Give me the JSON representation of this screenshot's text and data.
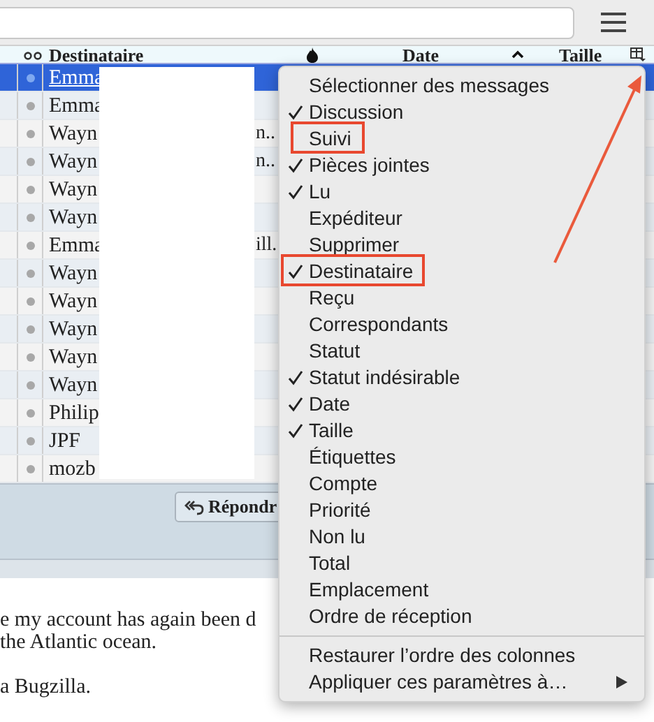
{
  "columns": [
    {
      "kind": "recipient",
      "label": "Destinataire",
      "sorted": false
    },
    {
      "kind": "junk",
      "sorted": false
    },
    {
      "kind": "date",
      "label": "Date",
      "sorted": true
    },
    {
      "kind": "size",
      "label": "Taille",
      "sorted": false
    }
  ],
  "rows": [
    {
      "recipient": "Emma",
      "selected": true
    },
    {
      "recipient": "Emma",
      "selected": false
    },
    {
      "recipient": "Wayn",
      "tail": "n..",
      "selected": false
    },
    {
      "recipient": "Wayn",
      "tail": "n..",
      "selected": false
    },
    {
      "recipient": "Wayn",
      "selected": false
    },
    {
      "recipient": "Wayn",
      "selected": false
    },
    {
      "recipient": "Emma",
      "tail": "ill.",
      "selected": false
    },
    {
      "recipient": "Wayn",
      "selected": false
    },
    {
      "recipient": "Wayn",
      "selected": false
    },
    {
      "recipient": "Wayn",
      "selected": false
    },
    {
      "recipient": "Wayn",
      "selected": false
    },
    {
      "recipient": "Wayn",
      "selected": false
    },
    {
      "recipient": "Philip",
      "selected": false
    },
    {
      "recipient": "JPF",
      "selected": false
    },
    {
      "recipient": "mozb",
      "selected": false
    }
  ],
  "reply_button": "Répondr",
  "message_body": [
    "e my account has again been d",
    "the Atlantic ocean.",
    "a Bugzilla."
  ],
  "column_menu": [
    {
      "kind": "item",
      "label": "Sélectionner des messages",
      "checked": false,
      "annotated": false
    },
    {
      "kind": "item",
      "label": "Discussion",
      "checked": true,
      "annotated": false
    },
    {
      "kind": "item",
      "label": "Suivi",
      "checked": false,
      "annotated": true
    },
    {
      "kind": "item",
      "label": "Pièces jointes",
      "checked": true,
      "annotated": false
    },
    {
      "kind": "item",
      "label": "Lu",
      "checked": true,
      "annotated": false
    },
    {
      "kind": "item",
      "label": "Expéditeur",
      "checked": false,
      "annotated": false
    },
    {
      "kind": "item",
      "label": "Supprimer",
      "checked": false,
      "annotated": false
    },
    {
      "kind": "item",
      "label": "Destinataire",
      "checked": true,
      "annotated": true
    },
    {
      "kind": "item",
      "label": "Reçu",
      "checked": false,
      "annotated": false
    },
    {
      "kind": "item",
      "label": "Correspondants",
      "checked": false,
      "annotated": false
    },
    {
      "kind": "item",
      "label": "Statut",
      "checked": false,
      "annotated": false
    },
    {
      "kind": "item",
      "label": "Statut indésirable",
      "checked": true,
      "annotated": false
    },
    {
      "kind": "item",
      "label": "Date",
      "checked": true,
      "annotated": false
    },
    {
      "kind": "item",
      "label": "Taille",
      "checked": true,
      "annotated": false
    },
    {
      "kind": "item",
      "label": "Étiquettes",
      "checked": false,
      "annotated": false
    },
    {
      "kind": "item",
      "label": "Compte",
      "checked": false,
      "annotated": false
    },
    {
      "kind": "item",
      "label": "Priorité",
      "checked": false,
      "annotated": false
    },
    {
      "kind": "item",
      "label": "Non lu",
      "checked": false,
      "annotated": false
    },
    {
      "kind": "item",
      "label": "Total",
      "checked": false,
      "annotated": false
    },
    {
      "kind": "item",
      "label": "Emplacement",
      "checked": false,
      "annotated": false
    },
    {
      "kind": "item",
      "label": "Ordre de réception",
      "checked": false,
      "annotated": false
    },
    {
      "kind": "separator"
    },
    {
      "kind": "item",
      "label": "Restaurer l’ordre des colonnes",
      "checked": false,
      "annotated": false
    },
    {
      "kind": "submenu",
      "label": "Appliquer ces paramètres à…",
      "checked": false,
      "annotated": false
    }
  ],
  "annotations": [
    {
      "kind": "arrow"
    }
  ]
}
